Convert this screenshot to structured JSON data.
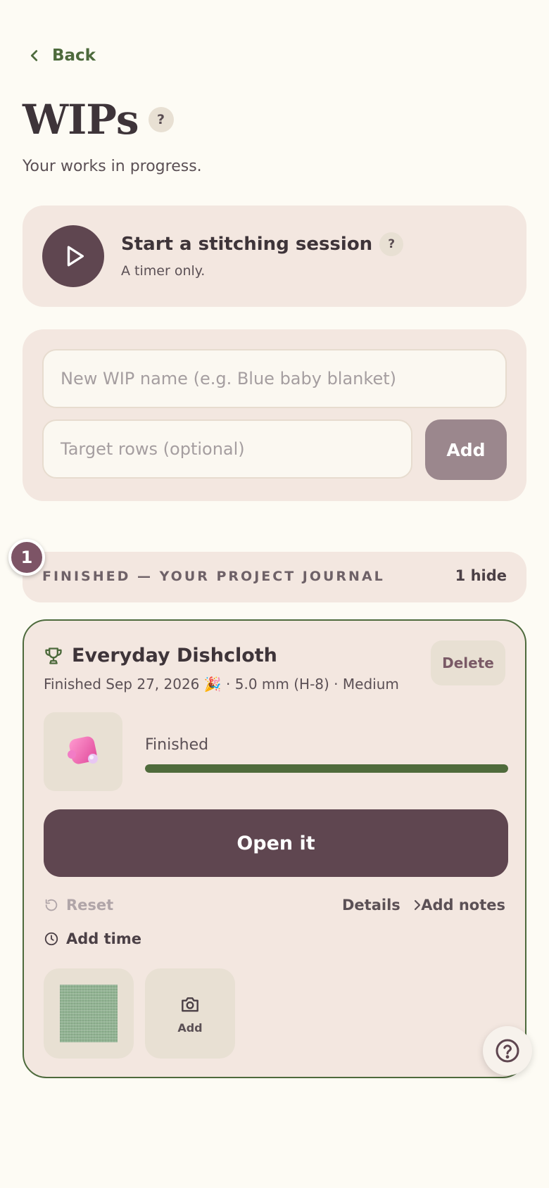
{
  "nav": {
    "back_label": "Back"
  },
  "header": {
    "title": "WIPs",
    "help_glyph": "?",
    "subtitle": "Your works in progress."
  },
  "session": {
    "title": "Start a stitching session",
    "help_glyph": "?",
    "subtitle": "A timer only."
  },
  "add_form": {
    "name_placeholder": "New WIP name (e.g. Blue baby blanket)",
    "rows_placeholder": "Target rows (optional)",
    "add_label": "Add"
  },
  "finished_section": {
    "badge_count": "1",
    "label": "FINISHED — YOUR PROJECT JOURNAL",
    "right_text": "1  hide"
  },
  "wip_card": {
    "icon": "trophy-icon",
    "title": "Everyday Dishcloth",
    "meta": "Finished Sep 27, 2026 🎉 · 5.0 mm (H-8) · Medium",
    "delete_label": "Delete",
    "progress_label": "Finished",
    "progress_fraction": 1.0,
    "open_label": "Open it",
    "reset_label": "Reset",
    "details_label": "Details",
    "notes_label": "Add notes",
    "add_time_label": "Add time",
    "photo_add_label": "Add"
  },
  "colors": {
    "accent_plum": "#5f4650",
    "accent_green": "#4f6b3c",
    "card_bg": "#f3e7e0",
    "page_bg": "#fdfbf4",
    "badge_plum": "#7d5466"
  }
}
